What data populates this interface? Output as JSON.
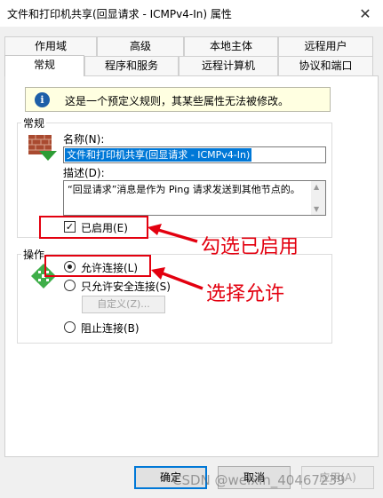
{
  "window": {
    "title": "文件和打印机共享(回显请求 - ICMPv4-In) 属性",
    "close_glyph": "✕"
  },
  "tabs_row1": [
    "作用域",
    "高级",
    "本地主体",
    "远程用户"
  ],
  "tabs_row2": [
    "常规",
    "程序和服务",
    "远程计算机",
    "协议和端口"
  ],
  "active_tab": "常规",
  "info": {
    "icon": "i",
    "text": "这是一个预定义规则，其某些属性无法被修改。"
  },
  "general": {
    "group_label": "常规",
    "name_label": "名称(N):",
    "name_value": "文件和打印机共享(回显请求 - ICMPv4-In)",
    "desc_label": "描述(D):",
    "desc_value": "“回显请求”消息是作为 Ping 请求发送到其他节点的。",
    "enabled_label": "已启用(E)",
    "enabled_checked": true
  },
  "action": {
    "group_label": "操作",
    "options": [
      {
        "label": "允许连接(L)",
        "checked": true
      },
      {
        "label": "只允许安全连接(S)",
        "checked": false
      },
      {
        "label": "阻止连接(B)",
        "checked": false
      }
    ],
    "customize_label": "自定义(Z)..."
  },
  "annotations": {
    "enable_note": "勾选已启用",
    "allow_note": "选择允许",
    "color": "#e3000f"
  },
  "buttons": {
    "ok": "确定",
    "cancel": "取消",
    "apply": "应用(A)"
  },
  "watermark": "CSDN @weixin_40467239",
  "icons": [
    "close-icon",
    "info-icon",
    "firewall-brick-icon",
    "action-arrows-icon",
    "checkmark-icon",
    "scroll-up-icon",
    "scroll-down-icon"
  ]
}
